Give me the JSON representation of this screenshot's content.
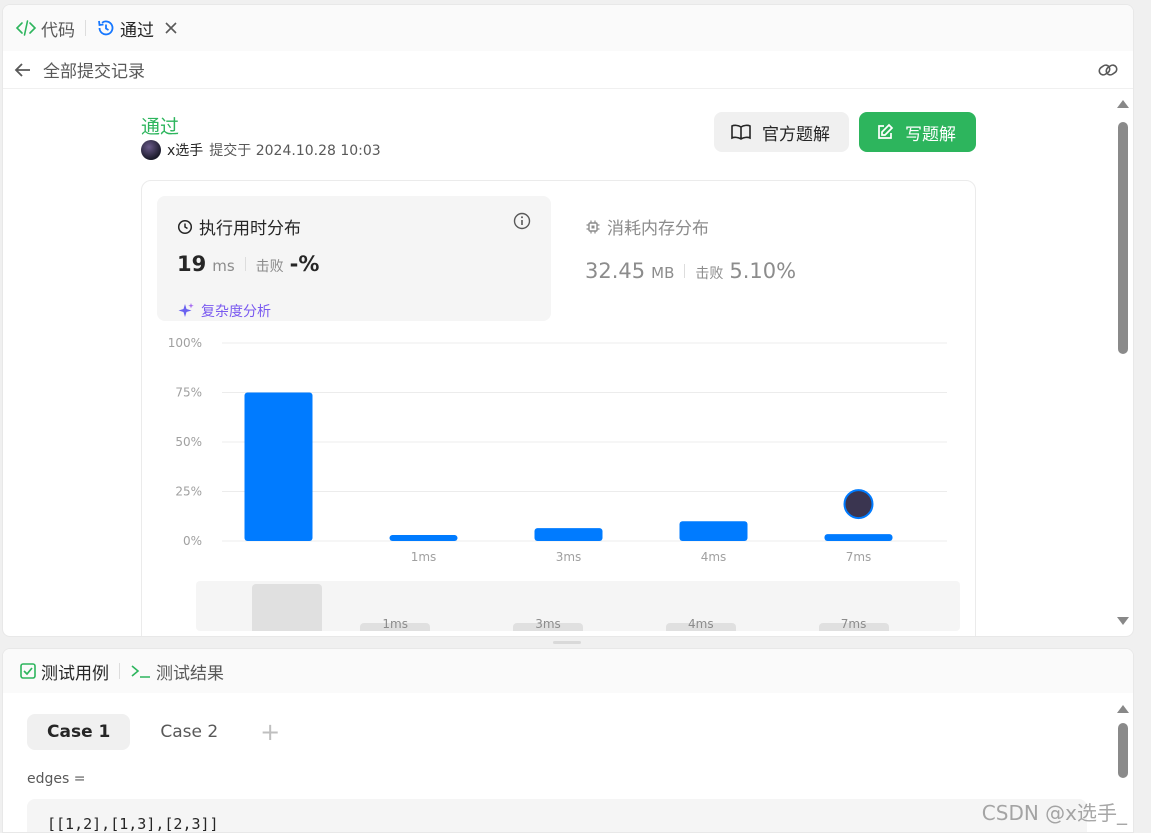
{
  "tabs": {
    "code": "代码",
    "passed": "通过"
  },
  "subbar": {
    "back_label": "全部提交记录"
  },
  "submission": {
    "status": "通过",
    "user": "x选手",
    "submitted_at": "提交于 2024.10.28 10:03"
  },
  "buttons": {
    "official": "官方题解",
    "write": "写题解"
  },
  "runtime": {
    "title": "执行用时分布",
    "value": "19",
    "unit": "ms",
    "beat_label": "击败",
    "beat_value": "-%",
    "complexity_link": "复杂度分析"
  },
  "memory": {
    "title": "消耗内存分布",
    "value": "32.45",
    "unit": "MB",
    "beat_label": "击败",
    "beat_value": "5.10%"
  },
  "chart_data": {
    "type": "bar",
    "categories": [
      "",
      "1ms",
      "3ms",
      "4ms",
      "7ms"
    ],
    "values": [
      75,
      3,
      6.5,
      10,
      3.5
    ],
    "ylim": [
      0,
      100
    ],
    "yticks": [
      "0%",
      "25%",
      "50%",
      "75%",
      "100%"
    ],
    "grid": true,
    "bar_color": "#007bff",
    "marker_on": "7ms"
  },
  "minimap": {
    "labels": [
      "1ms",
      "3ms",
      "4ms",
      "7ms"
    ]
  },
  "bottom_tabs": {
    "testcase": "测试用例",
    "result": "测试结果"
  },
  "cases": [
    "Case 1",
    "Case 2"
  ],
  "param": {
    "label": "edges =",
    "value": "[[1,2],[1,3],[2,3]]"
  },
  "watermark": "CSDN @x选手_",
  "colors": {
    "accent_green": "#2db55d",
    "bar_blue": "#007bff"
  }
}
